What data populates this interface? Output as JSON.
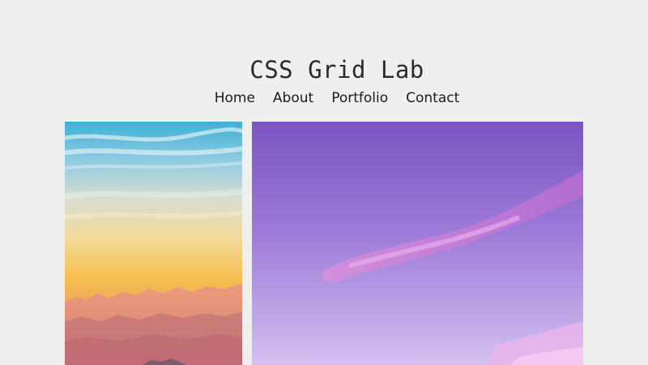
{
  "site": {
    "title": "CSS Grid Lab"
  },
  "nav": {
    "items": [
      {
        "label": "Home"
      },
      {
        "label": "About"
      },
      {
        "label": "Portfolio"
      },
      {
        "label": "Contact"
      }
    ]
  },
  "gallery": {
    "items": [
      {
        "subject": "sunset sky over mountain ridges"
      },
      {
        "subject": "purple sky with pink clouds"
      }
    ]
  },
  "colors": {
    "page_background": "#efefef",
    "text": "#1e1e1e"
  }
}
